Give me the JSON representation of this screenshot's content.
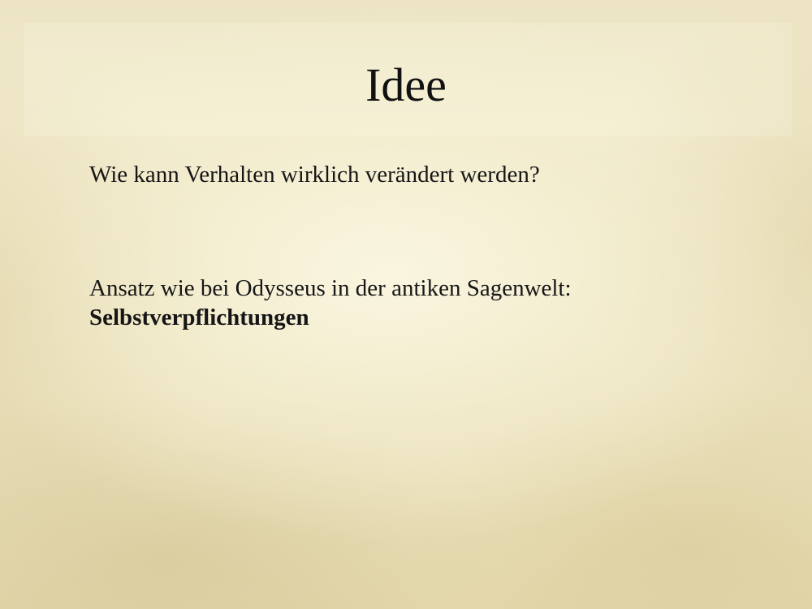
{
  "slide": {
    "title": "Idee",
    "question": "Wie kann Verhalten wirklich verändert werden?",
    "approach_line": "Ansatz wie bei Odysseus in der antiken Sagenwelt:",
    "approach_emphasis": "Selbstverpflichtungen"
  },
  "colors": {
    "background": "#efe7c6",
    "text": "#111111"
  }
}
